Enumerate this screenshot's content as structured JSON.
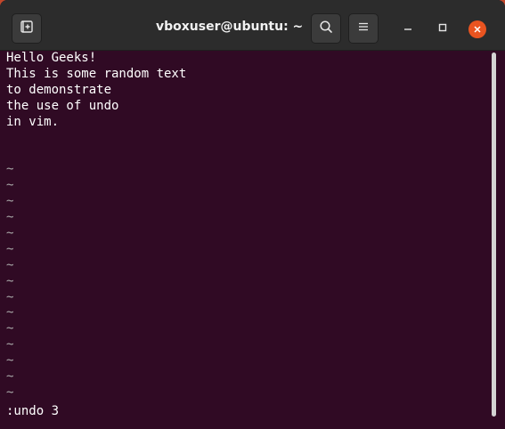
{
  "window": {
    "title": "vboxuser@ubuntu: ~"
  },
  "icons": {
    "new_tab": "new-tab-icon",
    "search": "search-icon",
    "menu": "hamburger-menu-icon",
    "minimize": "minimize-icon",
    "maximize": "maximize-icon",
    "close": "close-icon"
  },
  "colors": {
    "terminal_bg": "#300a24",
    "titlebar_bg": "#2c2c2c",
    "close_accent": "#e95420",
    "text": "#ffffff"
  },
  "terminal": {
    "lines": [
      "Hello Geeks!",
      "This is some random text",
      "to demonstrate",
      "the use of undo",
      "in vim."
    ],
    "empty_marker": "~",
    "command_line": ":undo 3"
  }
}
